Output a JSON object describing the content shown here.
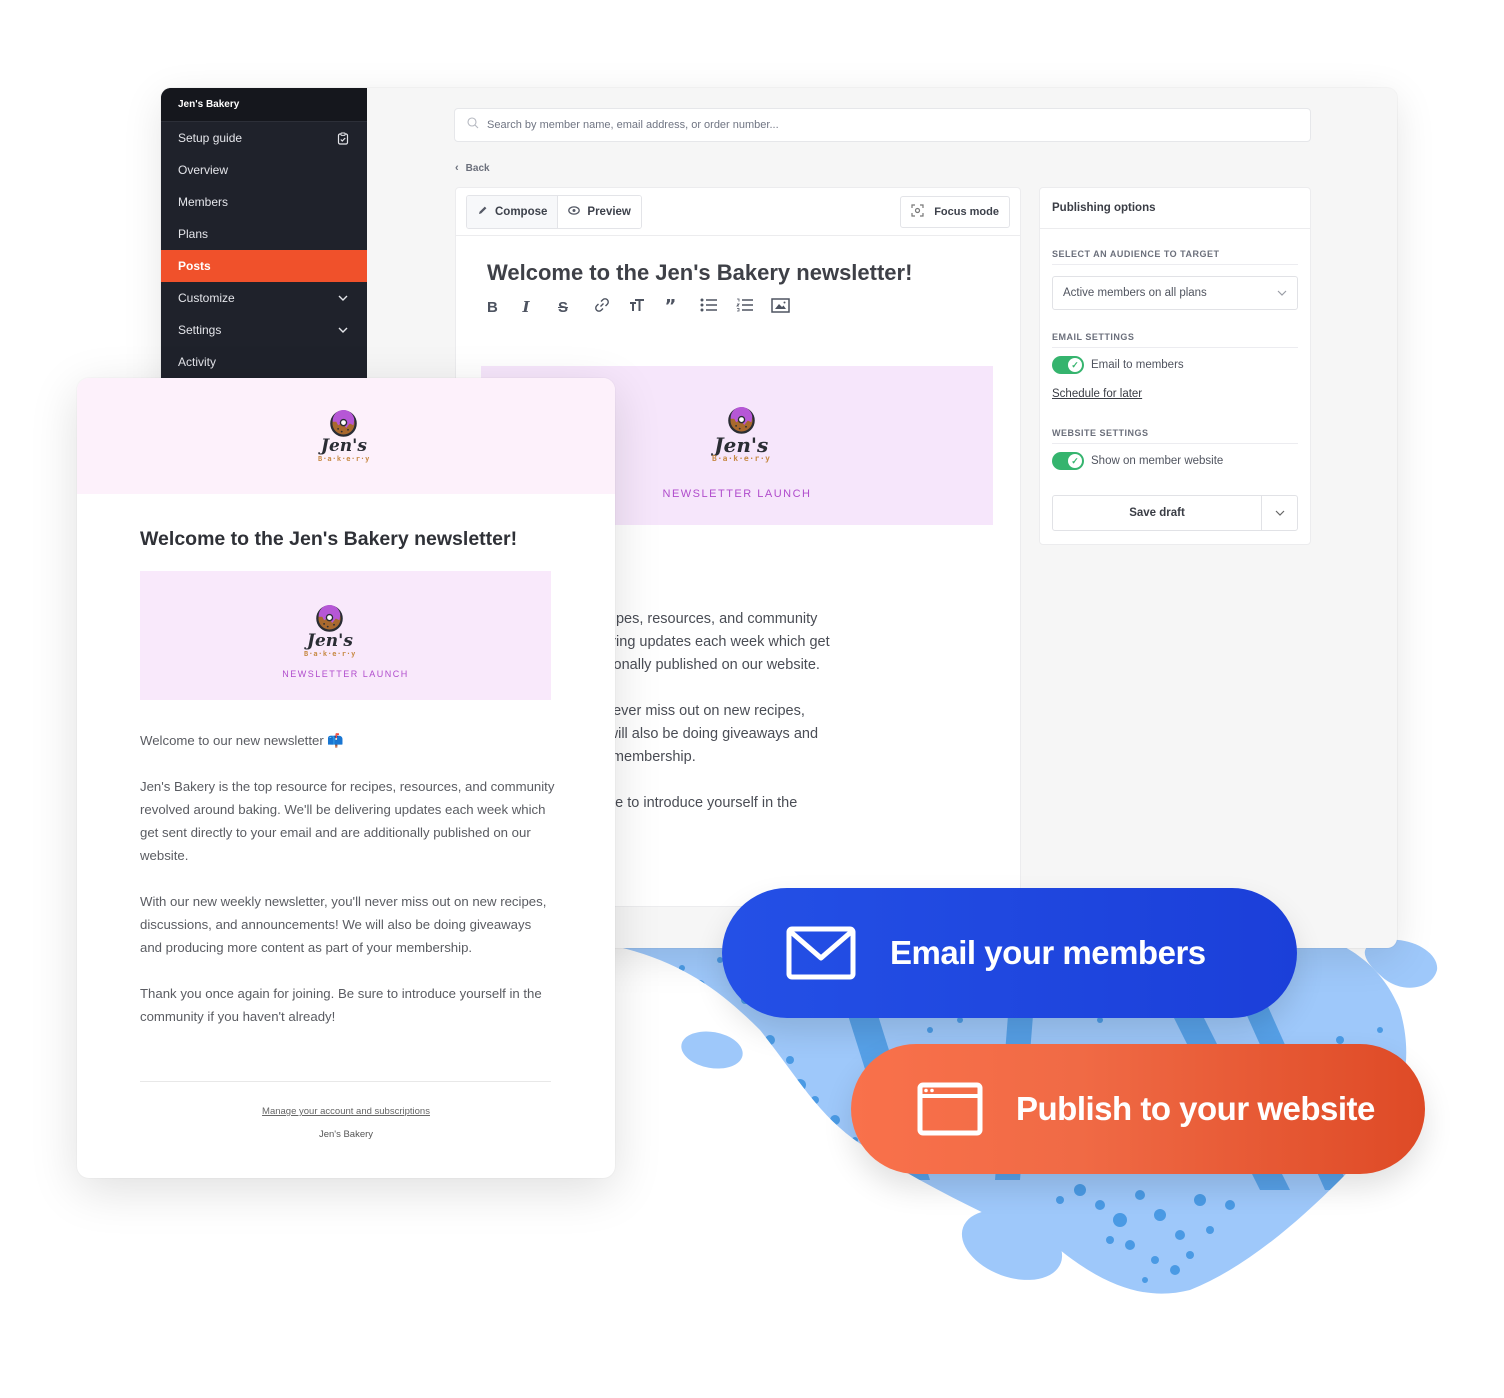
{
  "sidebar": {
    "brand": "Jen's Bakery",
    "items": [
      {
        "label": "Setup guide",
        "icon": "clipboard-check-icon"
      },
      {
        "label": "Overview"
      },
      {
        "label": "Members"
      },
      {
        "label": "Plans"
      },
      {
        "label": "Posts",
        "active": true
      },
      {
        "label": "Customize",
        "icon": "chevron-down-icon"
      },
      {
        "label": "Settings",
        "icon": "chevron-down-icon"
      },
      {
        "label": "Activity"
      }
    ]
  },
  "search": {
    "placeholder": "Search by member name, email address, or order number...",
    "icon": "search-icon"
  },
  "nav": {
    "back_label": "Back"
  },
  "editor": {
    "tabs": [
      {
        "label": "Compose",
        "icon": "pencil-icon",
        "active": true
      },
      {
        "label": "Preview",
        "icon": "eye-icon"
      }
    ],
    "focus_mode_label": "Focus mode",
    "title": "Welcome to the Jen's Bakery newsletter!",
    "format_tools": [
      "bold",
      "italic",
      "strikethrough",
      "link",
      "text-size",
      "quote",
      "bulleted-list",
      "numbered-list",
      "image"
    ],
    "banner_caption": "NEWSLETTER LAUNCH",
    "body_visible": [
      "/ newsletter 📫",
      ":op resource for recipes, resources, and community\n:ing. We'll be delivering updates each week which get\n email and are additionally published on our website.",
      "/ newsletter, you'll never miss out on new recipes,\nnouncements! We will also be doing giveaways and\ntent as part of your membership.",
      " in for joining. Be sure to introduce yourself in the\nven't already!"
    ]
  },
  "publishing": {
    "title": "Publishing options",
    "audience_label": "SELECT AN AUDIENCE TO TARGET",
    "audience_value": "Active members on all plans",
    "email_settings_label": "EMAIL SETTINGS",
    "email_toggle_label": "Email to members",
    "email_toggle_on": true,
    "schedule_label": "Schedule for later",
    "website_settings_label": "WEBSITE SETTINGS",
    "website_toggle_label": "Show on member website",
    "website_toggle_on": true,
    "save_label": "Save draft"
  },
  "email_preview": {
    "logo_name": "Jen's",
    "logo_sub": "B·a·k·e·r·y",
    "title": "Welcome to the Jen's Bakery newsletter!",
    "banner_caption": "NEWSLETTER LAUNCH",
    "paragraphs": [
      "Welcome to our new newsletter 📫",
      "Jen's Bakery is the top resource for recipes, resources, and community revolved around baking. We'll be delivering updates each week which get sent directly to your email and are additionally published on our website.",
      "With our new weekly newsletter, you'll never miss out on new recipes, discussions, and announcements! We will also be doing giveaways and producing more content as part of your membership.",
      "Thank you once again for joining. Be sure to introduce yourself in the community if you haven't already!"
    ],
    "footer_link": "Manage your account and subscriptions",
    "footer_name": "Jen's Bakery"
  },
  "callouts": {
    "email": {
      "label": "Email your members",
      "icon": "envelope-icon",
      "color": "#2450e6"
    },
    "publish": {
      "label": "Publish to your website",
      "icon": "browser-window-icon",
      "color": "#f06a45"
    }
  },
  "colors": {
    "sidebar_bg": "#1f222b",
    "active_nav": "#f0512b",
    "toggle_on": "#35b46e",
    "banner_bg": "#f6e6fb",
    "banner_text": "#b04ccc",
    "blob": "#9ec8fa",
    "blob_dots": "#4a9ae4"
  }
}
